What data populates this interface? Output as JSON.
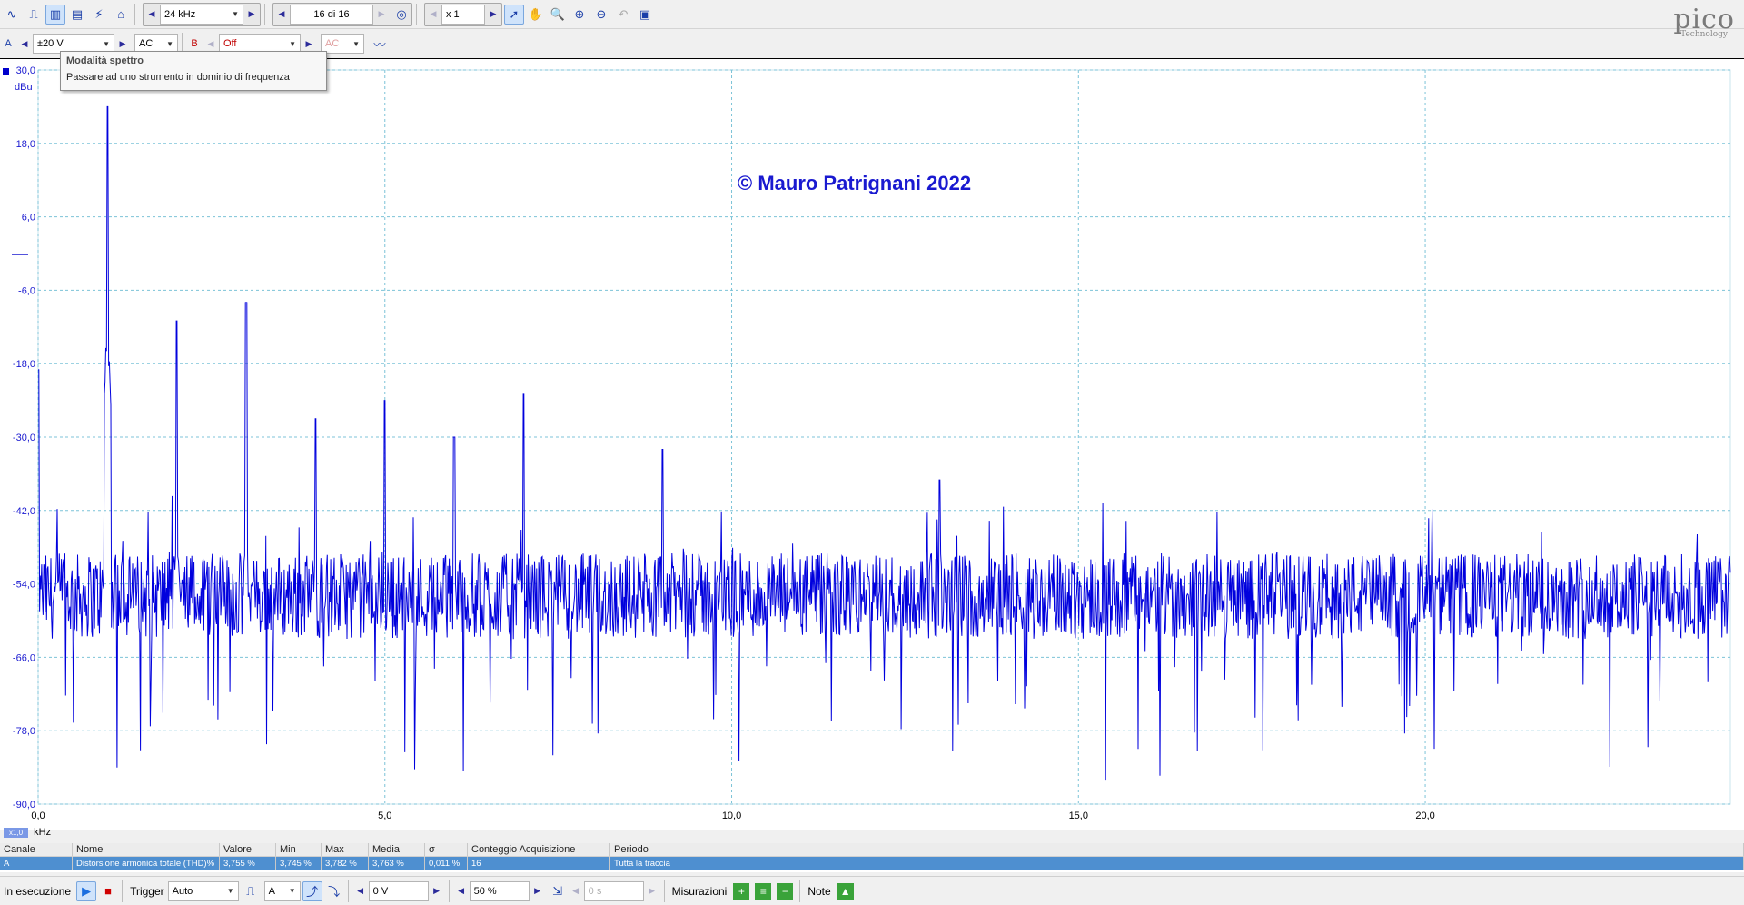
{
  "toolbar": {
    "timebase": "24 kHz",
    "capture_counter": "16 di 16",
    "zoom_factor": "x 1"
  },
  "channel_bar": {
    "channel_a_label": "A",
    "channel_a_range": "±20 V",
    "channel_a_coupling": "AC",
    "channel_b_label": "B",
    "channel_b_range": "Off",
    "channel_b_coupling": "AC"
  },
  "logo": {
    "word": "pico",
    "sub": "Technology"
  },
  "tooltip": {
    "title": "Modalità spettro",
    "body": "Passare ad uno strumento in dominio di frequenza"
  },
  "plot": {
    "copyright": "© Mauro Patrignani 2022",
    "y_unit": "dBu",
    "y_ticks": [
      "30,0",
      "18,0",
      "6,0",
      "-6,0",
      "-18,0",
      "-30,0",
      "-42,0",
      "-54,0",
      "-66,0",
      "-78,0",
      "-90,0"
    ],
    "x_ticks": [
      "0,0",
      "5,0",
      "10,0",
      "15,0",
      "20,0"
    ],
    "x_unit": "kHz",
    "x_zoom_badge": "x1,0",
    "trace_color": "#0000dd",
    "grid_color": "#7cc3d8"
  },
  "chart_data": {
    "type": "line",
    "title": "",
    "xlabel": "kHz",
    "ylabel": "dBu",
    "xlim": [
      0,
      24.4
    ],
    "ylim": [
      -90,
      30
    ],
    "grid": true,
    "peaks": [
      {
        "x": 0.0,
        "y": -19
      },
      {
        "x": 1.0,
        "y": 24
      },
      {
        "x": 2.0,
        "y": -11
      },
      {
        "x": 3.0,
        "y": -8
      },
      {
        "x": 4.0,
        "y": -27
      },
      {
        "x": 5.0,
        "y": -24
      },
      {
        "x": 6.0,
        "y": -30
      },
      {
        "x": 7.0,
        "y": -23
      },
      {
        "x": 9.0,
        "y": -32
      },
      {
        "x": 13.0,
        "y": -37
      }
    ],
    "noise_floor_range": [
      -66,
      -46
    ]
  },
  "measurements": {
    "headers": [
      "Canale",
      "Nome",
      "Valore",
      "Min",
      "Max",
      "Media",
      "σ",
      "Conteggio Acquisizione",
      "Periodo"
    ],
    "rows": [
      [
        "A",
        "Distorsione armonica totale (THD)%",
        "3,755 %",
        "3,745 %",
        "3,782 %",
        "3,763 %",
        "0,011 %",
        "16",
        "Tutta la traccia"
      ]
    ]
  },
  "bottom_bar": {
    "status": "In esecuzione",
    "trigger_label": "Trigger",
    "trigger_mode": "Auto",
    "trigger_channel": "A",
    "trigger_level": "0 V",
    "pretrigger": "50 %",
    "delay": "0 s",
    "measurements_label": "Misurazioni",
    "notes_label": "Note"
  }
}
